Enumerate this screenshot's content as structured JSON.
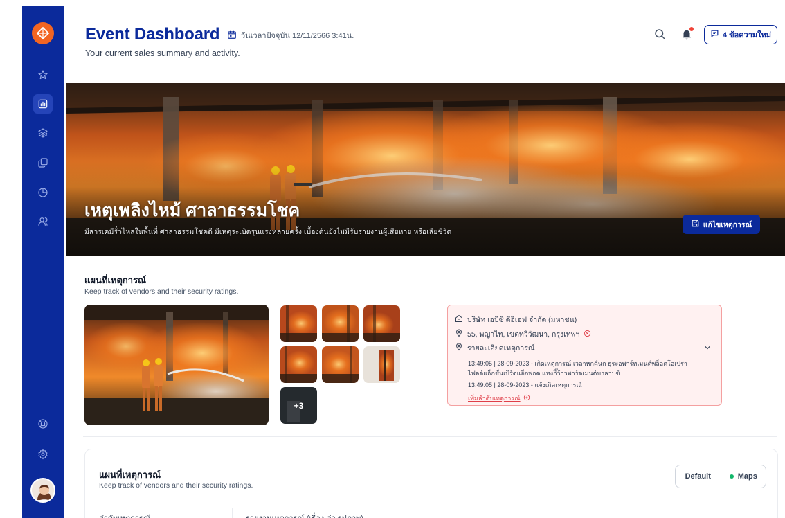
{
  "header": {
    "title": "Event Dashboard",
    "datetime": "วันเวลาปัจจุบัน 12/11/2566 3:41น.",
    "subtitle": "Your current sales summary and activity.",
    "new_messages_label": "4 ข้อความใหม่"
  },
  "sidebar": {
    "items": [
      {
        "icon": "star-icon"
      },
      {
        "icon": "chart-icon",
        "active": true
      },
      {
        "icon": "layers-icon"
      },
      {
        "icon": "copy-icon"
      },
      {
        "icon": "pie-chart-icon"
      },
      {
        "icon": "users-icon"
      }
    ],
    "bottom": [
      {
        "icon": "life-buoy-icon"
      },
      {
        "icon": "settings-icon"
      }
    ]
  },
  "hero": {
    "title": "เหตุเพลิงไหม้ ศาลาธรรมโชค",
    "subtitle": "มีสารเคมีรั่วไหลในพื้นที่ ศาลาธรรมโชคดี มีเหตุระเบิดรุนแรงหลายครั้ง เบื้องต้นยังไม่มีรับรายงานผู้เสียหาย หรือเสียชีวิต",
    "edit_button": "แก้ไขเหตุการณ์"
  },
  "map_section": {
    "title": "แผนที่เหตุการณ์",
    "subtitle": "Keep track of vendors and their security ratings.",
    "more_photos_label": "+3",
    "info": {
      "company": "บริษัท เอบีซี ดีอีเอฟ จำกัด (มหาชน)",
      "address": "55, พญาไท, เขตทวีวัฒนา, กรุงเทพฯ",
      "details_label": "รายละเอียดเหตุการณ์",
      "log": [
        "13:49:05 | 28-09-2023 - เกิดเหตุการณ์ เวลาหกคืนก ธุระอพาร์ทเมนต์พล็อตโอเปร่า",
        "ไฟลต์แอ็กชั่นเบิร์ดแอ็กพอต แทงกิ๊ว้าวพาร์ตเมนต์บาลาบซ์",
        "13:49:05 | 28-09-2023 - แจ้งเกิดเหตุการณ์"
      ],
      "add_label": "เพิ่มลำดับเหตุการณ์"
    }
  },
  "bottom_card": {
    "title": "แผนที่เหตุการณ์",
    "subtitle": "Keep track of vendors and their security ratings.",
    "toggle": {
      "default": "Default",
      "maps": "Maps"
    },
    "columns": [
      "ลำดับเหตุการณ์",
      "รายงานเหตุการณ์ (เรื่องเล่า รูปภาพ)"
    ]
  },
  "colors": {
    "brand": "#0b2a9b",
    "accent": "#f26522",
    "alert": "#e0404a",
    "success": "#12b76a"
  }
}
